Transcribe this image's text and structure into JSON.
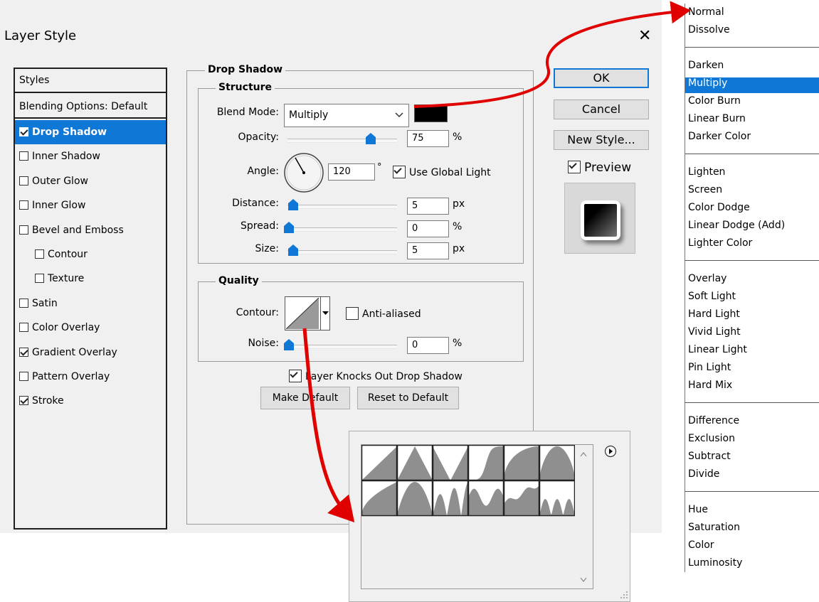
{
  "dialog": {
    "title": "Layer Style",
    "close_glyph": "✕",
    "styles_header": "Styles",
    "blending_options": "Blending Options: Default",
    "styles": [
      {
        "label": "Drop Shadow",
        "checked": true,
        "selected": true
      },
      {
        "label": "Inner Shadow",
        "checked": false
      },
      {
        "label": "Outer Glow",
        "checked": false
      },
      {
        "label": "Inner Glow",
        "checked": false
      },
      {
        "label": "Bevel and Emboss",
        "checked": false
      },
      {
        "label": "Contour",
        "checked": false,
        "indent": true
      },
      {
        "label": "Texture",
        "checked": false,
        "indent": true
      },
      {
        "label": "Satin",
        "checked": false
      },
      {
        "label": "Color Overlay",
        "checked": false
      },
      {
        "label": "Gradient Overlay",
        "checked": true
      },
      {
        "label": "Pattern Overlay",
        "checked": false
      },
      {
        "label": "Stroke",
        "checked": true
      }
    ]
  },
  "drop_shadow": {
    "title": "Drop Shadow",
    "structure": {
      "title": "Structure",
      "blend_mode_label": "Blend Mode:",
      "blend_mode_value": "Multiply",
      "shadow_color": "#000000",
      "opacity_label": "Opacity:",
      "opacity_value": "75",
      "percent": "%",
      "angle_label": "Angle:",
      "angle_value": "120",
      "degree_symbol": "°",
      "use_global_light": "Use Global Light",
      "distance_label": "Distance:",
      "distance_value": "5",
      "spread_label": "Spread:",
      "spread_value": "0",
      "size_label": "Size:",
      "size_value": "5",
      "px": "px"
    },
    "quality": {
      "title": "Quality",
      "contour_label": "Contour:",
      "anti_aliased": "Anti-aliased",
      "noise_label": "Noise:",
      "noise_value": "0"
    },
    "layer_knocks_out": "Layer Knocks Out Drop Shadow",
    "make_default": "Make Default",
    "reset_default": "Reset to Default"
  },
  "buttons": {
    "ok": "OK",
    "cancel": "Cancel",
    "new_style": "New Style...",
    "preview": "Preview"
  },
  "blend_dropdown": {
    "selected": "Multiply",
    "groups": [
      [
        "Normal",
        "Dissolve"
      ],
      [
        "Darken",
        "Multiply",
        "Color Burn",
        "Linear Burn",
        "Darker Color"
      ],
      [
        "Lighten",
        "Screen",
        "Color Dodge",
        "Linear Dodge (Add)",
        "Lighter Color"
      ],
      [
        "Overlay",
        "Soft Light",
        "Hard Light",
        "Vivid Light",
        "Linear Light",
        "Pin Light",
        "Hard Mix"
      ],
      [
        "Difference",
        "Exclusion",
        "Subtract",
        "Divide"
      ],
      [
        "Hue",
        "Saturation",
        "Color",
        "Luminosity"
      ]
    ]
  },
  "contour_picker": {
    "presets": [
      "linear",
      "cone",
      "cone-inverted",
      "gaussian",
      "half-round",
      "ring",
      "ring-double",
      "rolling-slope",
      "rounded-steps",
      "sawtooth",
      "cove-deep",
      "cove-shallow"
    ]
  },
  "accent_color": "#0f78d7",
  "annotation_color": "#e00000"
}
